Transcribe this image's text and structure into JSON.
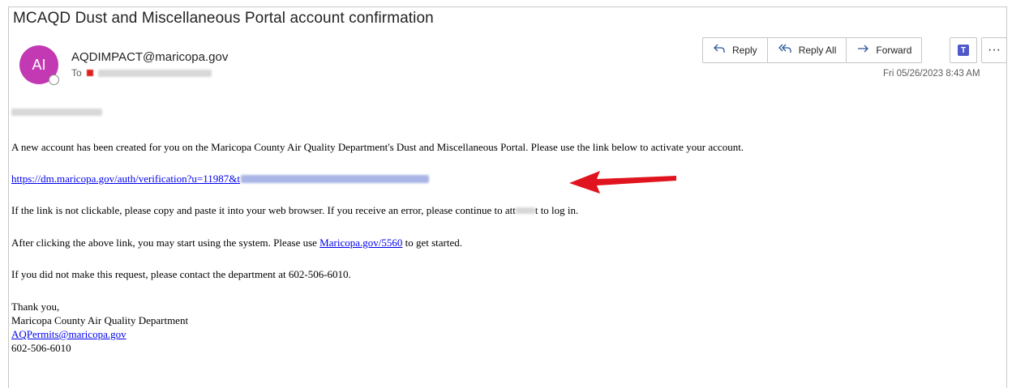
{
  "email": {
    "subject": "MCAQD Dust and Miscellaneous Portal account confirmation",
    "avatar_initials": "AI",
    "avatar_color": "#c239b3",
    "sender": "AQDIMPACT@maricopa.gov",
    "to_label": "To",
    "datetime": "Fri 05/26/2023 8:43 AM"
  },
  "actions": {
    "reply": {
      "label": "Reply",
      "icon": "reply-icon"
    },
    "reply_all": {
      "label": "Reply All",
      "icon": "reply-all-icon"
    },
    "forward": {
      "label": "Forward",
      "icon": "forward-icon"
    },
    "teams": {
      "icon": "teams-icon"
    },
    "more": {
      "label": "···",
      "icon": "more-options-icon"
    }
  },
  "body": {
    "para1": "A new account has been created for you on the Maricopa County Air Quality Department's Dust and Miscellaneous Portal. Please use the link below to activate your account.",
    "link_visible": "https://dm.maricopa.gov/auth/verification?u=11987&t",
    "para2_before": "If the link is not clickable, please copy and paste it into your web browser. If you receive an error, please continue to att",
    "para2_after": "t to log in.",
    "para3_before": "After clicking the above link, you may start using the system. Please use ",
    "para3_link": "Maricopa.gov/5560",
    "para3_after": " to get started.",
    "para4": "If you did not make this request, please contact the department at 602-506-6010.",
    "sig_thanks": "Thank you,",
    "sig_org": "Maricopa County Air Quality Department",
    "sig_email": "AQPermits@maricopa.gov",
    "sig_phone": "602-506-6010"
  },
  "colors": {
    "link": "#0000ee",
    "arrow": "#e0141e",
    "action_icon": "#2b579a"
  }
}
